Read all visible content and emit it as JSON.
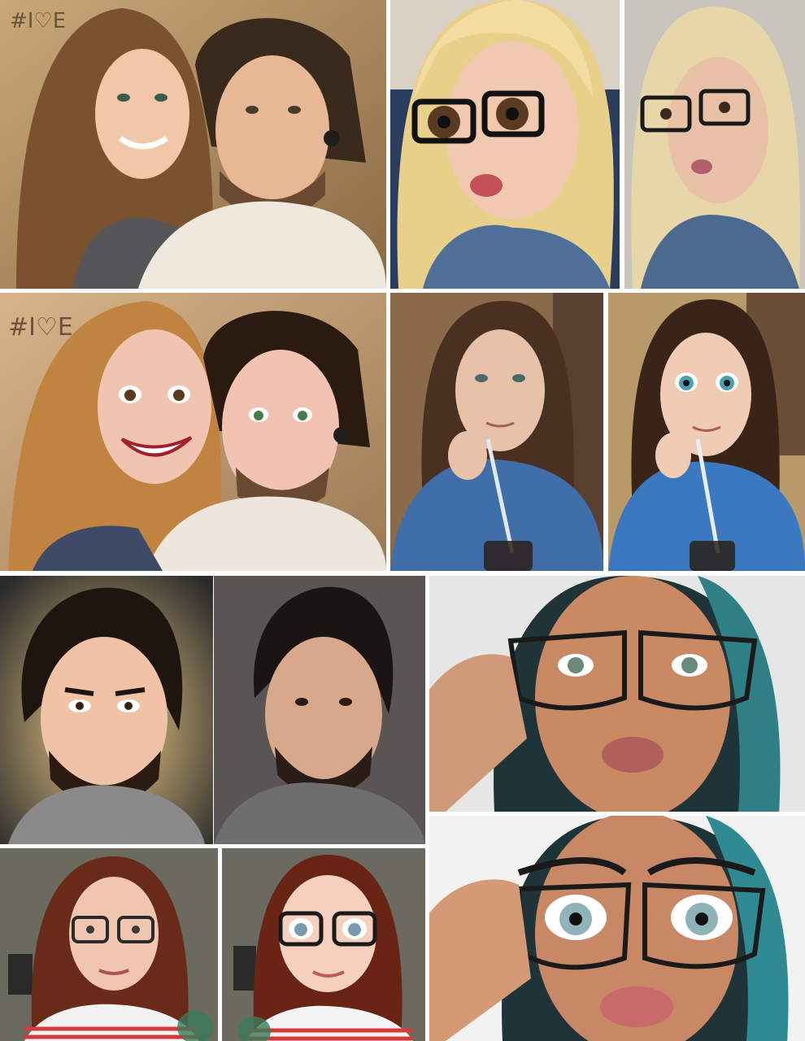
{
  "collage": {
    "wall_text_photo": "#I♡E",
    "wall_text_cartoon": "#I♡E"
  },
  "tiles": [
    {
      "name": "couple-selfie-photo",
      "kind": "photo"
    },
    {
      "name": "blonde-glasses-cartoon",
      "kind": "cartoon"
    },
    {
      "name": "blonde-glasses-photo",
      "kind": "photo"
    },
    {
      "name": "couple-selfie-cartoon",
      "kind": "cartoon"
    },
    {
      "name": "woman-denim-straw-photo",
      "kind": "photo"
    },
    {
      "name": "woman-denim-straw-cartoon",
      "kind": "cartoon"
    },
    {
      "name": "bearded-man-cartoon",
      "kind": "cartoon"
    },
    {
      "name": "bearded-man-photo",
      "kind": "photo"
    },
    {
      "name": "teal-hair-glasses-photo",
      "kind": "photo"
    },
    {
      "name": "redhead-glasses-photo",
      "kind": "photo"
    },
    {
      "name": "redhead-glasses-cartoon",
      "kind": "cartoon"
    },
    {
      "name": "teal-hair-glasses-cartoon",
      "kind": "cartoon"
    }
  ],
  "colors": {
    "border": "#ffffff",
    "denim": "#3f6ea8",
    "skin_light": "#f1c9ae",
    "skin_tan": "#c98a63",
    "hair_blonde": "#e8cf8a",
    "hair_brown": "#5b3a22",
    "hair_teal": "#2f7f86"
  }
}
